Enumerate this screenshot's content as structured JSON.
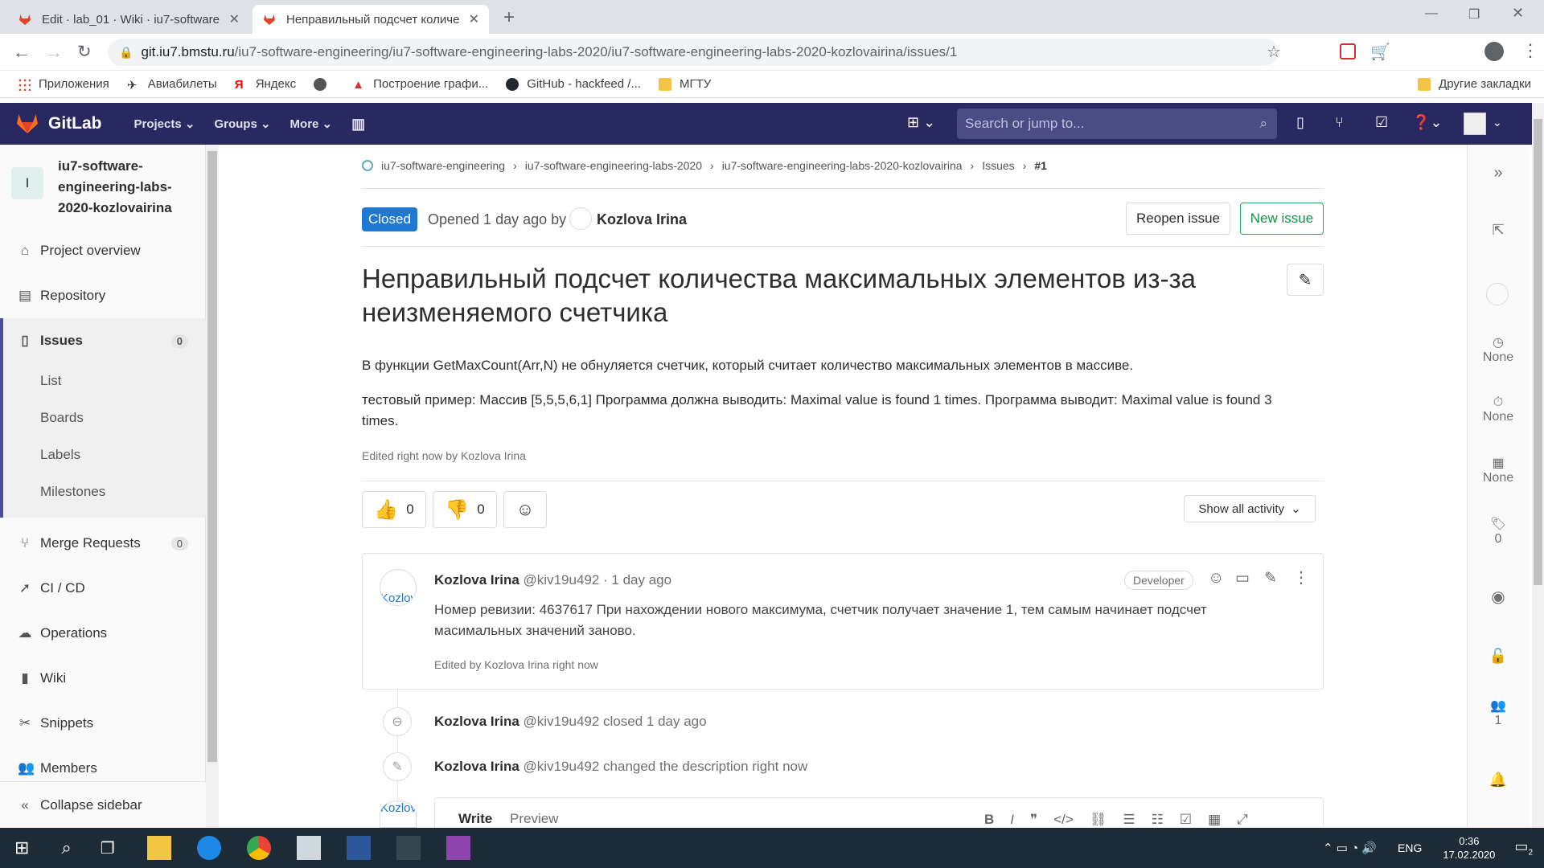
{
  "browser": {
    "tabs": [
      {
        "title": "Edit · lab_01 · Wiki · iu7-software",
        "active": false
      },
      {
        "title": "Неправильный подсчет количе",
        "active": true
      }
    ],
    "url_domain": "git.iu7.bmstu.ru",
    "url_path": "/iu7-software-engineering/iu7-software-engineering-labs-2020/iu7-software-engineering-labs-2020-kozlovairina/issues/1",
    "bookmarks": [
      "Приложения",
      "Авиабилеты",
      "Яндекс",
      "Построение графи...",
      "GitHub - hackfeed /...",
      "МГТУ"
    ],
    "other_bookmarks": "Другие закладки"
  },
  "gitlab_nav": {
    "brand": "GitLab",
    "menu": [
      "Projects",
      "Groups",
      "More"
    ],
    "search_placeholder": "Search or jump to..."
  },
  "sidebar": {
    "project_initial": "I",
    "project_name": "iu7-software-engineering-labs-2020-kozlovairina",
    "items": [
      {
        "label": "Project overview",
        "icon": "home-icon"
      },
      {
        "label": "Repository",
        "icon": "doc-icon"
      },
      {
        "label": "Issues",
        "icon": "issues-icon",
        "count": "0"
      },
      {
        "label": "Merge Requests",
        "icon": "merge-icon",
        "count": "0"
      },
      {
        "label": "CI / CD",
        "icon": "rocket-icon"
      },
      {
        "label": "Operations",
        "icon": "cloud-icon"
      },
      {
        "label": "Wiki",
        "icon": "book-icon"
      },
      {
        "label": "Snippets",
        "icon": "scissors-icon"
      },
      {
        "label": "Members",
        "icon": "users-icon"
      }
    ],
    "issues_sub": [
      "List",
      "Boards",
      "Labels",
      "Milestones"
    ],
    "collapse": "Collapse sidebar"
  },
  "breadcrumb": [
    "iu7-software-engineering",
    "iu7-software-engineering-labs-2020",
    "iu7-software-engineering-labs-2020-kozlovairina",
    "Issues",
    "#1"
  ],
  "issue": {
    "status": "Closed",
    "opened": "Opened 1 day ago by",
    "author": "Kozlova Irina",
    "reopen_button": "Reopen issue",
    "new_button": "New issue",
    "title": "Неправильный подсчет количества максимальных элементов из-за неизменяемого счетчика",
    "desc_1": "В функции GetMaxCount(Arr,N) не обнуляется счетчик, который считает количество максимальных элементов в массиве.",
    "desc_2": "тестовый пример: Массив [5,5,5,6,1] Программа должна выводить: Maximal value is found 1 times. Программа выводит: Maximal value is found 3 times.",
    "edited": "Edited right now by Kozlova Irina",
    "thumbs_up": "0",
    "thumbs_down": "0",
    "activity_filter": "Show all activity"
  },
  "comment": {
    "author": "Kozlova Irina",
    "handle": "@kiv19u492 · 1 day ago",
    "role": "Developer",
    "avatar_alt": "Kozlov",
    "text": "Номер ревизии: 4637617 При нахождении нового максимума, счетчик получает значение 1, тем самым начинает подсчет масимальных значений заново.",
    "edited": "Edited by Kozlova Irina right now"
  },
  "system_notes": [
    {
      "author": "Kozlova Irina",
      "text": "@kiv19u492 closed 1 day ago"
    },
    {
      "author": "Kozlova Irina",
      "text": "@kiv19u492 changed the description right now"
    }
  ],
  "editor": {
    "write": "Write",
    "preview": "Preview",
    "avatar_alt": "Kozlov"
  },
  "right_sidebar": {
    "assignee": "None",
    "milestone": "None",
    "due": "None",
    "labels": "0",
    "participants": "1"
  },
  "taskbar": {
    "lang": "ENG",
    "time": "0:36",
    "date": "17.02.2020",
    "notifications": "2"
  }
}
